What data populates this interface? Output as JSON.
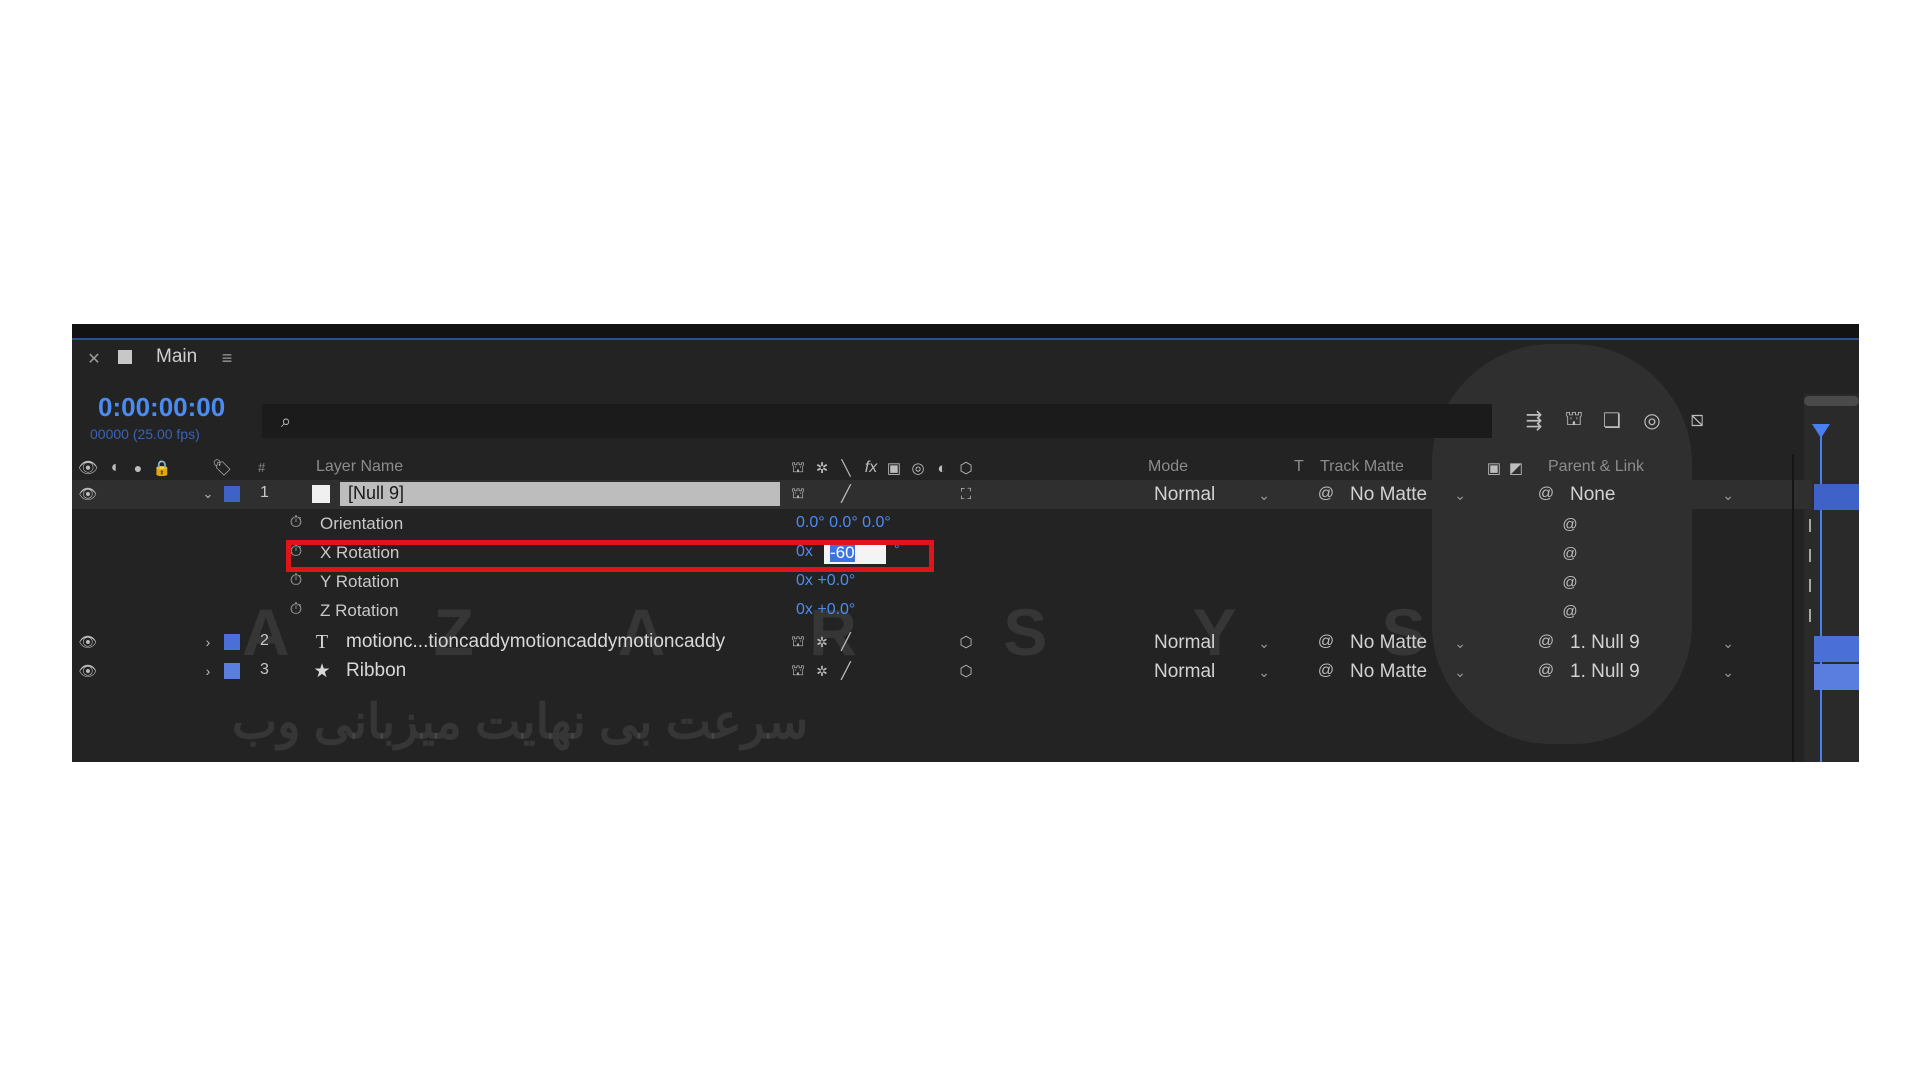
{
  "panel": {
    "tab_title": "Main",
    "timecode": "0:00:00:00",
    "frame_info": "00000 (25.00 fps)"
  },
  "columns": {
    "number": "#",
    "layer_name": "Layer Name",
    "mode": "Mode",
    "t": "T",
    "track_matte": "Track Matte",
    "parent_link": "Parent & Link"
  },
  "layers": [
    {
      "index": "1",
      "name": "[Null 9]",
      "mode": "Normal",
      "track_matte": "No Matte",
      "parent": "None",
      "color": "#3f62c9"
    },
    {
      "index": "2",
      "name": "motionc...tioncaddymotioncaddymotioncaddy",
      "mode": "Normal",
      "track_matte": "No Matte",
      "parent": "1. Null 9",
      "color": "#4a6fd6"
    },
    {
      "index": "3",
      "name": "Ribbon",
      "mode": "Normal",
      "track_matte": "No Matte",
      "parent": "1. Null 9",
      "color": "#5a7ee0"
    }
  ],
  "properties": [
    {
      "name": "Orientation",
      "value": "0.0° 0.0° 0.0°"
    },
    {
      "name": "X Rotation",
      "revolutions": "0x",
      "edit_value": "-60",
      "suffix": "°"
    },
    {
      "name": "Y Rotation",
      "value": "0x +0.0°"
    },
    {
      "name": "Z Rotation",
      "value": "0x +0.0°"
    }
  ],
  "watermark": {
    "latin": "A Z A R S Y S",
    "persian": "سرعت بی نهایت میزبانی وب"
  },
  "colors": {
    "highlight_box": "#e0141b",
    "accent_blue": "#4b8cf2",
    "playhead": "#4a7ff0"
  }
}
